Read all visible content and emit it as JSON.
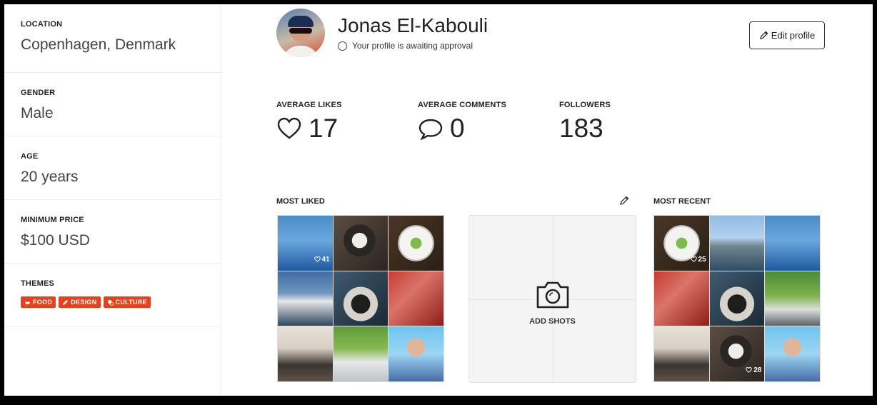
{
  "sidebar": {
    "location": {
      "label": "LOCATION",
      "value": "Copenhagen, Denmark"
    },
    "gender": {
      "label": "GENDER",
      "value": "Male"
    },
    "age": {
      "label": "AGE",
      "value": "20 years"
    },
    "price": {
      "label": "MINIMUM PRICE",
      "value": "$100 USD"
    },
    "themes": {
      "label": "THEMES",
      "tags": [
        "FOOD",
        "DESIGN",
        "CULTURE"
      ]
    }
  },
  "profile": {
    "name": "Jonas El-Kabouli",
    "status": "Your profile is awaiting approval",
    "edit_label": "Edit profile"
  },
  "stats": {
    "likes": {
      "label": "AVERAGE LIKES",
      "value": "17"
    },
    "comments": {
      "label": "AVERAGE COMMENTS",
      "value": "0"
    },
    "followers": {
      "label": "FOLLOWERS",
      "value": "183"
    }
  },
  "most_liked": {
    "title": "MOST LIKED",
    "badges": {
      "first": "41"
    }
  },
  "add_shots": {
    "label": "ADD SHOTS"
  },
  "most_recent": {
    "title": "MOST RECENT",
    "badges": {
      "first": "25",
      "eighth": "28"
    }
  }
}
